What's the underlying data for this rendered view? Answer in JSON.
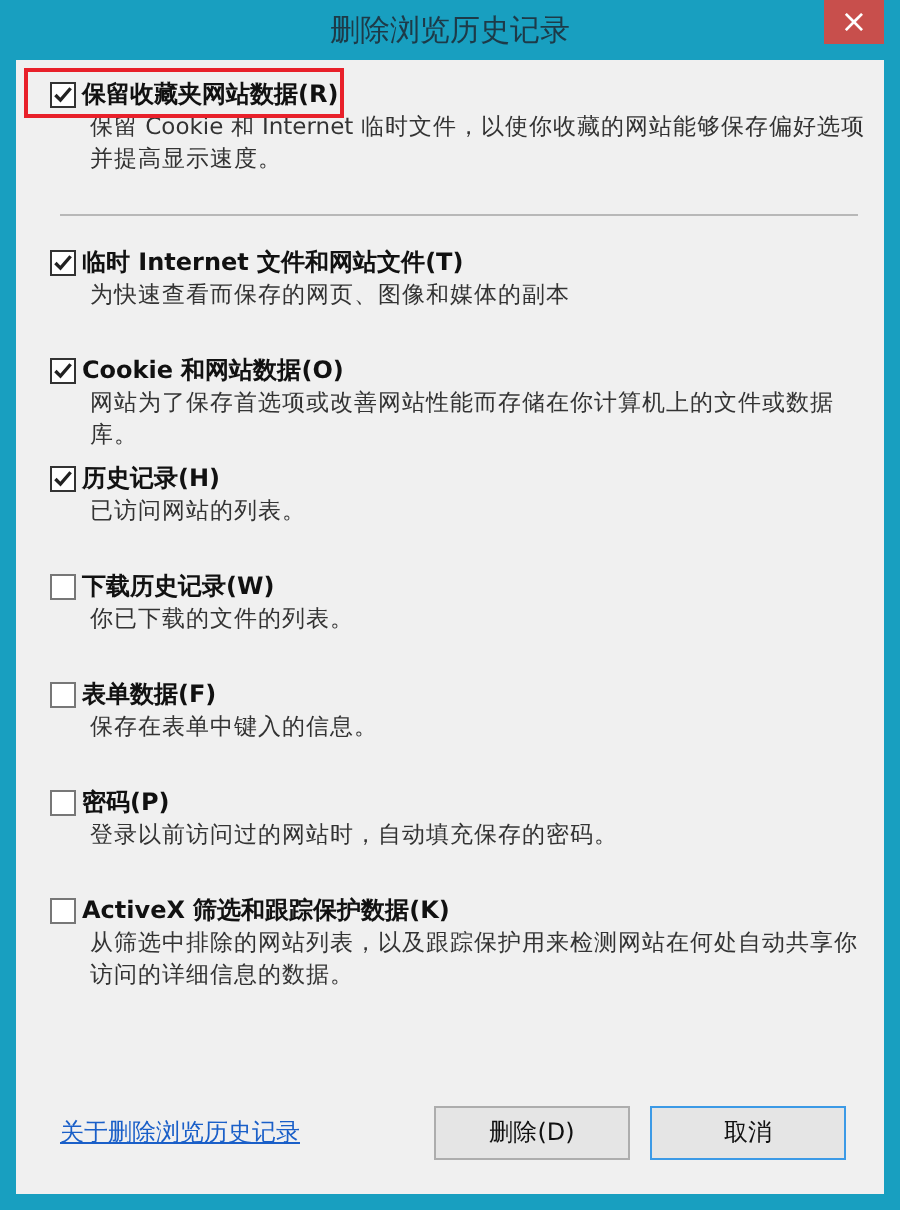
{
  "window": {
    "title": "删除浏览历史记录",
    "close": "×"
  },
  "items": [
    {
      "label": "保留收藏夹网站数据(R)",
      "description": "保留 Cookie 和 Internet 临时文件，以使你收藏的网站能够保存偏好选项并提高显示速度。",
      "checked": true,
      "highlighted": true
    },
    {
      "label": "临时 Internet 文件和网站文件(T)",
      "description": "为快速查看而保存的网页、图像和媒体的副本",
      "checked": true,
      "highlighted": false
    },
    {
      "label": "Cookie 和网站数据(O)",
      "description": "网站为了保存首选项或改善网站性能而存储在你计算机上的文件或数据库。",
      "checked": true,
      "highlighted": false
    },
    {
      "label": "历史记录(H)",
      "description": "已访问网站的列表。",
      "checked": true,
      "highlighted": false
    },
    {
      "label": "下载历史记录(W)",
      "description": "你已下载的文件的列表。",
      "checked": false,
      "highlighted": false
    },
    {
      "label": "表单数据(F)",
      "description": "保存在表单中键入的信息。",
      "checked": false,
      "highlighted": false
    },
    {
      "label": "密码(P)",
      "description": "登录以前访问过的网站时，自动填充保存的密码。",
      "checked": false,
      "highlighted": false
    },
    {
      "label": "ActiveX 筛选和跟踪保护数据(K)",
      "description": "从筛选中排除的网站列表，以及跟踪保护用来检测网站在何处自动共享你访问的详细信息的数据。",
      "checked": false,
      "highlighted": false
    }
  ],
  "link": "关于删除浏览历史记录",
  "buttons": [
    {
      "label": "删除(D)",
      "focused": false
    },
    {
      "label": "取消",
      "focused": true
    }
  ]
}
